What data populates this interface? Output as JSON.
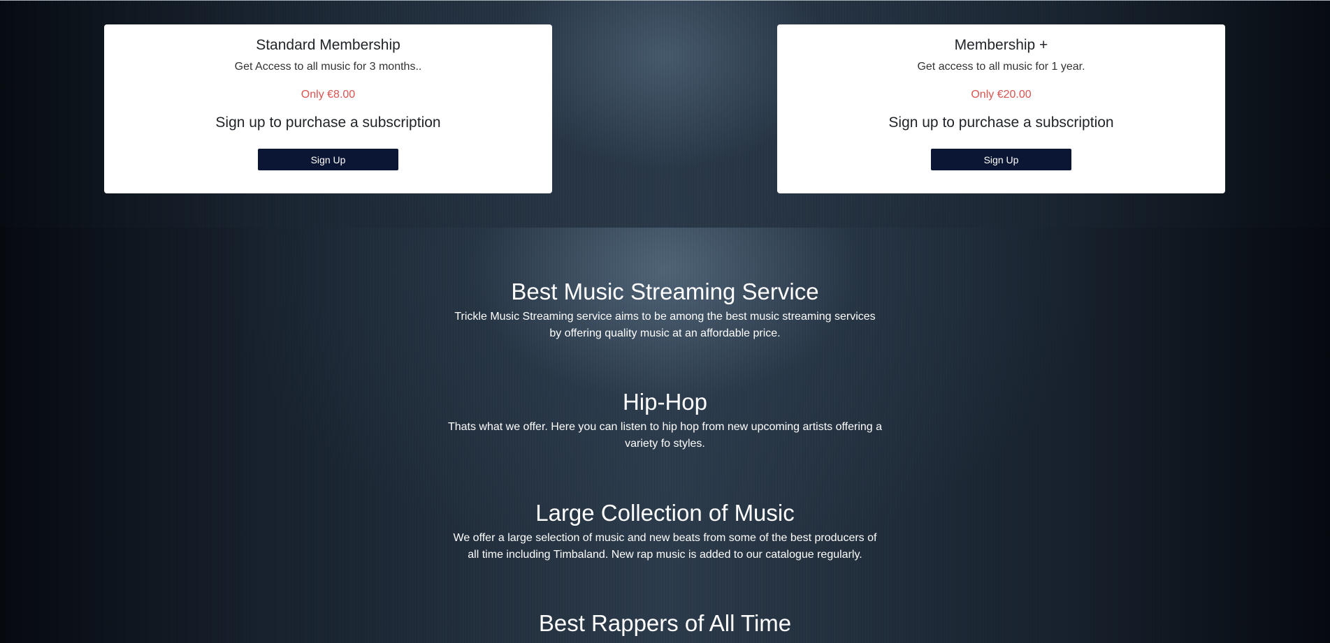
{
  "memberships": [
    {
      "title": "Standard Membership",
      "description": "Get Access to all music for 3 months..",
      "price": "Only €8.00",
      "cta": "Sign up to purchase a subscription",
      "button_label": "Sign Up"
    },
    {
      "title": "Membership +",
      "description": "Get access to all music for 1 year.",
      "price": "Only €20.00",
      "cta": "Sign up to purchase a subscription",
      "button_label": "Sign Up"
    }
  ],
  "features": [
    {
      "heading": "Best Music Streaming Service",
      "text": "Trickle Music Streaming service aims to be among the best music streaming services by offering quality music at an affordable price."
    },
    {
      "heading": "Hip-Hop",
      "text": "Thats what we offer. Here you can listen to hip hop from new upcoming artists offering a variety fo styles."
    },
    {
      "heading": "Large Collection of Music",
      "text": "We offer a large selection of music and new beats from some of the best producers of all time including Timbaland. New rap music is added to our catalogue regularly."
    },
    {
      "heading": "Best Rappers of All Time",
      "text": ""
    }
  ],
  "colors": {
    "price": "#d9534f",
    "button_bg": "#0a1633",
    "card_bg": "#ffffff"
  }
}
